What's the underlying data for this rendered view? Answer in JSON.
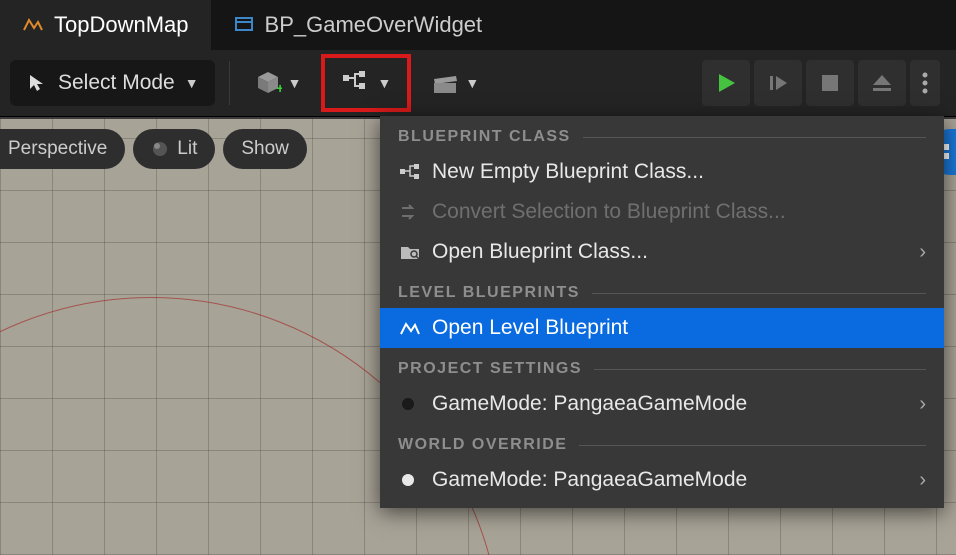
{
  "tabs": {
    "items": [
      {
        "label": "TopDownMap",
        "active": true
      },
      {
        "label": "BP_GameOverWidget",
        "active": false
      }
    ]
  },
  "toolbar": {
    "select_mode_label": "Select Mode"
  },
  "viewport": {
    "pills": {
      "perspective": "Perspective",
      "lit": "Lit",
      "show": "Show"
    }
  },
  "dropdown": {
    "sections": {
      "blueprint_class": {
        "title": "BLUEPRINT CLASS",
        "items": {
          "new_empty": "New Empty Blueprint Class...",
          "convert": "Convert Selection to Blueprint Class...",
          "open": "Open Blueprint Class..."
        }
      },
      "level_blueprints": {
        "title": "LEVEL BLUEPRINTS",
        "items": {
          "open_level": "Open Level Blueprint"
        }
      },
      "project_settings": {
        "title": "PROJECT SETTINGS",
        "items": {
          "gamemode": "GameMode: PangaeaGameMode"
        }
      },
      "world_override": {
        "title": "WORLD OVERRIDE",
        "items": {
          "gamemode": "GameMode: PangaeaGameMode"
        }
      }
    }
  }
}
